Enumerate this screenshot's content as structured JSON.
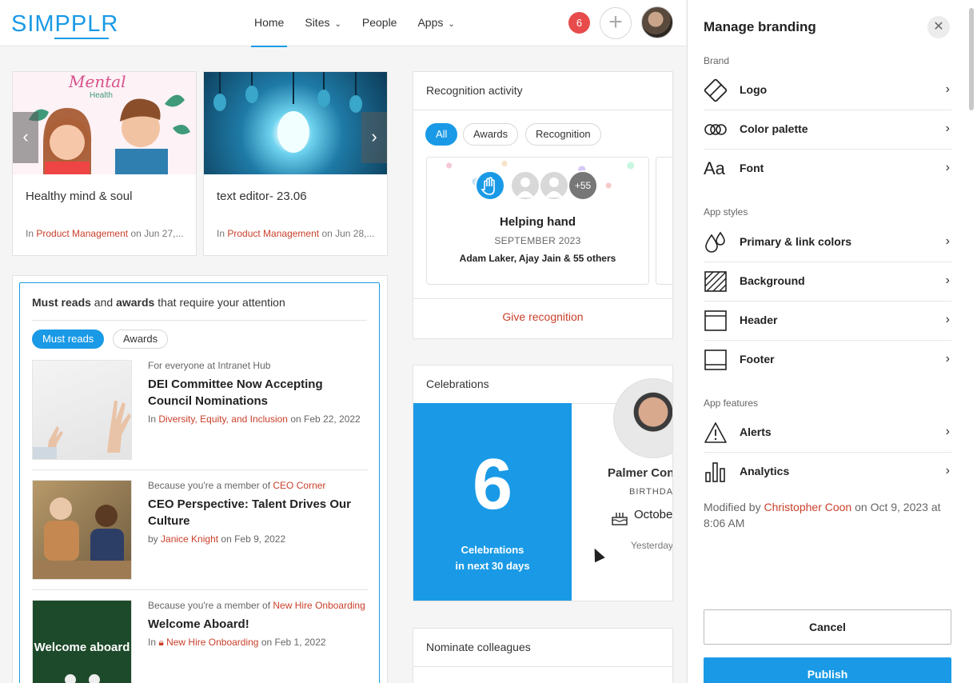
{
  "header": {
    "logo": "SIMPPLR",
    "nav": [
      {
        "label": "Home",
        "dropdown": false
      },
      {
        "label": "Sites",
        "dropdown": true
      },
      {
        "label": "People",
        "dropdown": false
      },
      {
        "label": "Apps",
        "dropdown": true
      }
    ],
    "notification_count": "6",
    "add_symbol": "+"
  },
  "features": [
    {
      "title": "Healthy mind & soul",
      "prefix": "In",
      "site": "Product Management",
      "suffix": "on Jun 27,...",
      "image_text": "Mental",
      "image_subtext": "Health"
    },
    {
      "title": "text editor- 23.06",
      "prefix": "In",
      "site": "Product Management",
      "suffix": "on Jun 28,..."
    }
  ],
  "must_reads": {
    "title_parts": [
      "Must reads",
      " and ",
      "awards",
      " that require your attention"
    ],
    "tabs": [
      "Must reads",
      "Awards"
    ],
    "items": [
      {
        "context": "For everyone at Intranet Hub",
        "context_link": "",
        "title": "DEI Committee Now Accepting Council Nominations",
        "meta_prefix": "In",
        "meta_link": "Diversity, Equity, and Inclusion",
        "meta_suffix": "on Feb 22, 2022"
      },
      {
        "context": "Because you're a member of",
        "context_link": "CEO Corner",
        "title": "CEO Perspective: Talent Drives Our Culture",
        "meta_prefix": "by",
        "meta_link": "Janice Knight",
        "meta_suffix": "on Feb 9, 2022"
      },
      {
        "context": "Because you're a member of",
        "context_link": "New Hire Onboarding",
        "title": "Welcome Aboard!",
        "meta_prefix": "In",
        "meta_link": "New Hire Onboarding",
        "meta_suffix": "on Feb 1, 2022",
        "image_text": "Welcome aboard"
      }
    ]
  },
  "recognition": {
    "title": "Recognition activity",
    "filters": [
      "All",
      "Awards",
      "Recognition"
    ],
    "card": {
      "name": "Helping hand",
      "date": "SEPTEMBER 2023",
      "people": "Adam Laker, Ajay Jain & 55 others",
      "extra_count": "+55"
    },
    "give_label": "Give recognition"
  },
  "celebrations": {
    "title": "Celebrations",
    "count": "6",
    "label_line1": "Celebrations",
    "label_line2": "in next 30 days",
    "person": "Palmer Con",
    "type": "BIRTHDAY",
    "date": "Octobe",
    "when": "Yesterday"
  },
  "nominate": {
    "title": "Nominate colleagues"
  },
  "branding_panel": {
    "title": "Manage branding",
    "close_symbol": "✕",
    "sections": [
      {
        "label": "Brand",
        "items": [
          {
            "label": "Logo",
            "icon": "logo-icon"
          },
          {
            "label": "Color palette",
            "icon": "color-palette-icon"
          },
          {
            "label": "Font",
            "icon": "font-icon"
          }
        ]
      },
      {
        "label": "App styles",
        "items": [
          {
            "label": "Primary & link colors",
            "icon": "droplets-icon"
          },
          {
            "label": "Background",
            "icon": "background-icon"
          },
          {
            "label": "Header",
            "icon": "header-icon"
          },
          {
            "label": "Footer",
            "icon": "footer-icon"
          }
        ]
      },
      {
        "label": "App features",
        "items": [
          {
            "label": "Alerts",
            "icon": "alert-icon"
          },
          {
            "label": "Analytics",
            "icon": "analytics-icon"
          }
        ]
      }
    ],
    "modified_prefix": "Modified by",
    "modified_by": "Christopher Coon",
    "modified_suffix": "on Oct 9, 2023 at 8:06 AM",
    "cancel_label": "Cancel",
    "publish_label": "Publish",
    "font_glyph": "Aa"
  },
  "colors": {
    "accent": "#1a9ae6",
    "link": "#c9402b",
    "badge": "#e84b4b"
  }
}
